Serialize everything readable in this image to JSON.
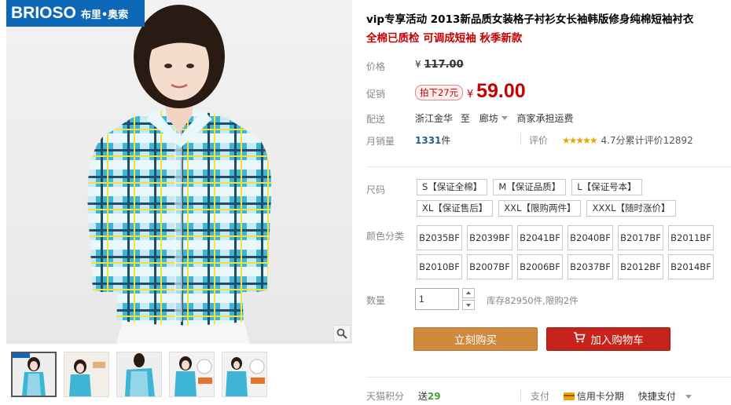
{
  "gallery": {
    "brand_name": "BRIOSO",
    "brand_sub": "布里•奥索",
    "zoom_icon": "magnifier-icon",
    "thumbnails": [
      "model-front",
      "model-front-logo",
      "model-side",
      "model-front-cotton-badge",
      "model-closeup-cotton-badge"
    ]
  },
  "product": {
    "title": "vip专享活动 2013新品质女装格子衬衫女长袖韩版修身纯棉短袖衬衣",
    "subtitle": "全棉已质检 可调成短袖 秋季新款"
  },
  "price": {
    "label": "价格",
    "currency": "¥",
    "original": "117.00",
    "promo_label": "促销",
    "promo_tag": "拍下27元",
    "sale": "59.00"
  },
  "shipping": {
    "label": "配送",
    "from": "浙江金华",
    "to_word": "至",
    "to": "廊坊",
    "fee": "商家承担运费"
  },
  "sales": {
    "label": "月销量",
    "count": "1331",
    "unit": "件",
    "rating_label": "评价",
    "stars": "★★★★★",
    "score": "4.7分",
    "reviews": "累计评价12892"
  },
  "sizes": {
    "label": "尺码",
    "options": [
      "S【保证全棉】",
      "M【保证品质】",
      "L【保证号本】",
      "XL【保证售后】",
      "XXL【限购两件】",
      "XXXL【随时涨价】"
    ]
  },
  "colors": {
    "label": "颜色分类",
    "options": [
      "B2035BF",
      "B2039BF",
      "B2041BF",
      "B2040BF",
      "B2017BF",
      "B2011BF",
      "B2010BF",
      "B2007BF",
      "B2006BF",
      "B2037BF",
      "B2012BF",
      "B2014BF"
    ]
  },
  "quantity": {
    "label": "数量",
    "value": "1",
    "stock": "库存82950件,限购2件"
  },
  "actions": {
    "buy_now": "立刻购买",
    "add_cart": "加入购物车",
    "cart_icon": "cart-icon"
  },
  "footer": {
    "points_label": "天猫积分",
    "points_prefix": "送",
    "points_value": "29",
    "pay_label": "支付",
    "pay_card": "信用卡分期",
    "pay_quick": "快捷支付"
  },
  "colors_theme": {
    "brand_blue": "#0e68b8",
    "price_red": "#c40000",
    "buy_orange": "#d1893e",
    "cart_red": "#c7231b"
  }
}
